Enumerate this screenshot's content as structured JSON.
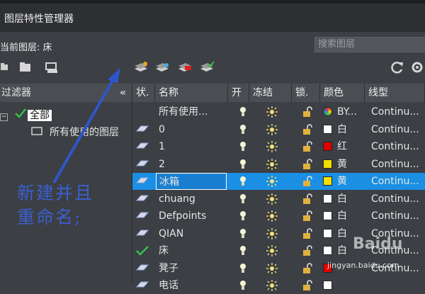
{
  "window": {
    "title": "图层特性管理器"
  },
  "current_layer": {
    "label": "当前图层: 床"
  },
  "search": {
    "placeholder": "搜索图层"
  },
  "sidebar": {
    "header": "过滤器",
    "collapse_glyph": "«",
    "tree": [
      {
        "label": "全部"
      },
      {
        "label": "所有使用的图层"
      }
    ]
  },
  "columns": {
    "status": "状.",
    "name": "名称",
    "on": "开",
    "freeze": "冻结",
    "lock": "锁.",
    "color": "颜色",
    "linetype": "线型"
  },
  "rows": [
    {
      "name": "所有使用...",
      "color_name": "BY...",
      "color": "#ffffff",
      "linetype": "Continu...",
      "status": "none"
    },
    {
      "name": "0",
      "color_name": "白",
      "color": "#ffffff",
      "linetype": "Continu...",
      "status": "layer"
    },
    {
      "name": "1",
      "color_name": "红",
      "color": "#e00000",
      "linetype": "Continu...",
      "status": "layer"
    },
    {
      "name": "2",
      "color_name": "黄",
      "color": "#f2e000",
      "linetype": "Continu...",
      "status": "layer"
    },
    {
      "name": "冰箱",
      "color_name": "黄",
      "color": "#f2e000",
      "linetype": "Continu...",
      "status": "layer",
      "selected": true
    },
    {
      "name": "chuang",
      "color_name": "白",
      "color": "#ffffff",
      "linetype": "Continu...",
      "status": "layer"
    },
    {
      "name": "Defpoints",
      "color_name": "白",
      "color": "#ffffff",
      "linetype": "Continu...",
      "status": "layer"
    },
    {
      "name": "QIAN",
      "color_name": "白",
      "color": "#ffffff",
      "linetype": "Continu...",
      "status": "layer"
    },
    {
      "name": "床",
      "color_name": "白",
      "color": "#ffffff",
      "linetype": "Continu...",
      "status": "current"
    },
    {
      "name": "凳子",
      "color_name": "",
      "color": "#e00000",
      "linetype": "Continu...",
      "status": "layer"
    },
    {
      "name": "电话",
      "color_name": "",
      "color": "#ffffff",
      "linetype": "",
      "status": "layer"
    }
  ],
  "annotation": {
    "line1": "新建并且",
    "line2": "重命名;"
  },
  "watermark": {
    "text": "jingyan.baidu.com",
    "big": "Baidu"
  },
  "colors": {
    "selection": "#1a8fe3",
    "accent_arrow": "#2f56c8"
  }
}
